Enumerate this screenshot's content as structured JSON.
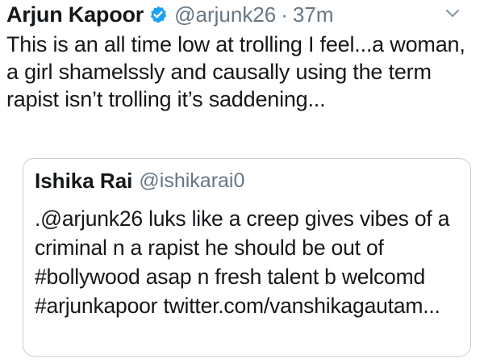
{
  "tweet": {
    "author_name": "Arjun Kapoor",
    "handle": "@arjunk26",
    "separator": "·",
    "time": "37m",
    "verified_icon": "verified-badge-icon",
    "menu_icon": "chevron-down-icon",
    "text": "This is an all time low at trolling I feel...a woman, a girl shamelssly and causally using the term rapist isn’t trolling it’s saddening..."
  },
  "quoted_tweet": {
    "author_name": "Ishika Rai",
    "handle": "@ishikarai0",
    "text": ".@arjunk26 luks like a creep gives vibes of a criminal n a rapist he should be out of #bollywood asap n fresh talent b welcomd #arjunkapoor twitter.com/vanshikagautam..."
  },
  "colors": {
    "text": "#14171a",
    "secondary": "#657786",
    "verified_blue": "#1da1f2",
    "border": "#c4cfd6"
  }
}
